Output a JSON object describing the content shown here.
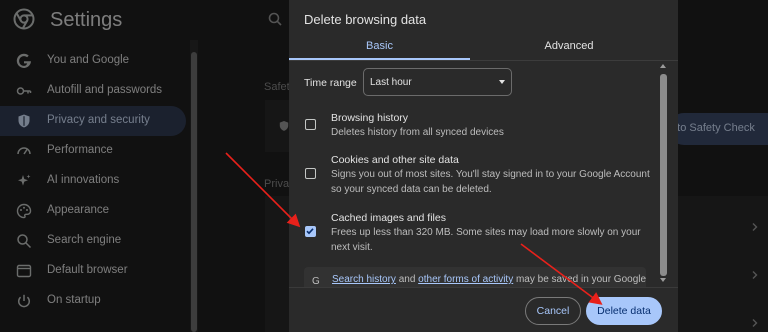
{
  "settings": {
    "title": "Settings",
    "nav": [
      {
        "label": "You and Google",
        "icon": "google-g-icon",
        "active": false
      },
      {
        "label": "Autofill and passwords",
        "icon": "key-icon",
        "active": false
      },
      {
        "label": "Privacy and security",
        "icon": "shield-icon",
        "active": true
      },
      {
        "label": "Performance",
        "icon": "speedometer-icon",
        "active": false
      },
      {
        "label": "AI innovations",
        "icon": "sparkle-icon",
        "active": false
      },
      {
        "label": "Appearance",
        "icon": "palette-icon",
        "active": false
      },
      {
        "label": "Search engine",
        "icon": "search-icon",
        "active": false
      },
      {
        "label": "Default browser",
        "icon": "browser-window-icon",
        "active": false
      },
      {
        "label": "On startup",
        "icon": "power-icon",
        "active": false
      }
    ],
    "bg_safety_snip": "Safet",
    "bg_privacy_snip": "Priva",
    "safety_check_button": "o to Safety Check"
  },
  "dialog": {
    "title": "Delete browsing data",
    "tabs": [
      {
        "label": "Basic",
        "selected": true
      },
      {
        "label": "Advanced",
        "selected": false
      }
    ],
    "time_range": {
      "label": "Time range",
      "value": "Last hour"
    },
    "options": [
      {
        "title": "Browsing history",
        "desc": "Deletes history from all synced devices",
        "checked": false
      },
      {
        "title": "Cookies and other site data",
        "desc": "Signs you out of most sites. You'll stay signed in to your Google Account so your synced data can be deleted.",
        "checked": false
      },
      {
        "title": "Cached images and files",
        "desc": "Frees up less than 320 MB. Some sites may load more slowly on your next visit.",
        "checked": true
      }
    ],
    "info": {
      "link1": "Search history",
      "mid": " and ",
      "link2": "other forms of activity",
      "rest": " may be saved in your Google"
    },
    "cancel_label": "Cancel",
    "delete_label": "Delete data"
  },
  "colors": {
    "accent": "#a8c7fa",
    "arrow": "#e8211b",
    "active_nav_bg": "#323c55"
  }
}
